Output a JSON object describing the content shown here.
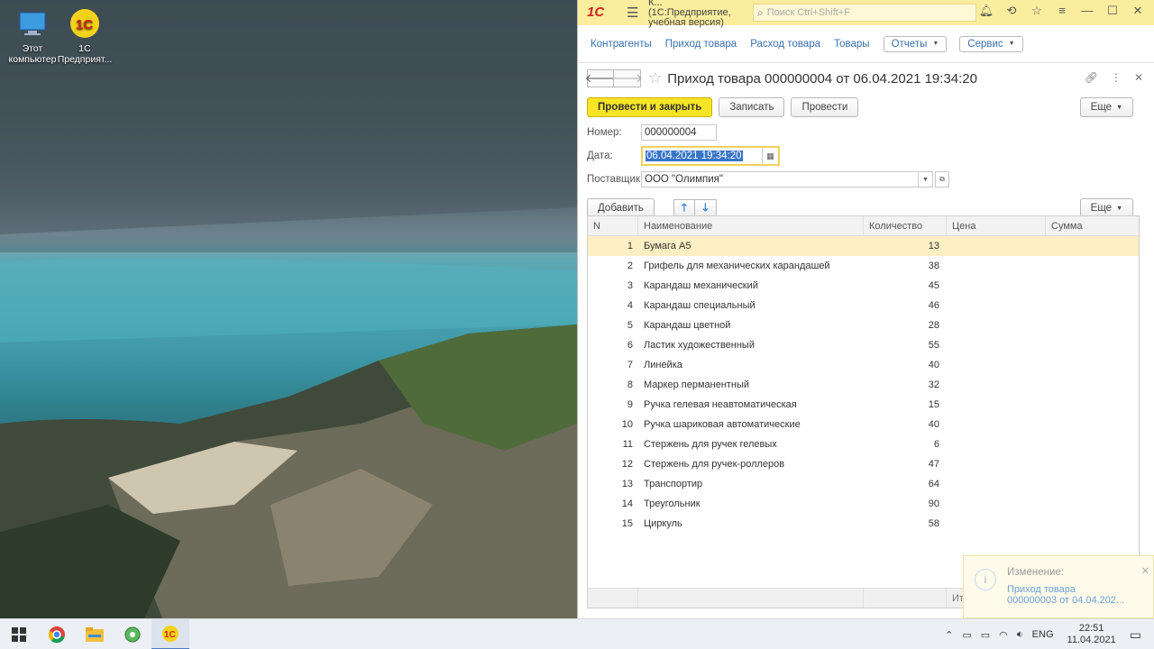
{
  "desktop": {
    "icons": [
      {
        "label": "Этот компьютер",
        "icon": "computer-icon"
      },
      {
        "label": "1С Предприят...",
        "icon": "1c-icon"
      }
    ]
  },
  "app": {
    "logo": "1С",
    "title_line1": "К... (1С:Предприятие,",
    "title_line2": "учебная версия)",
    "search_placeholder": "Поиск Ctrl+Shift+F",
    "sections": [
      "Контрагенты",
      "Приход товара",
      "Расход товара",
      "Товары"
    ],
    "reports_label": "Отчеты",
    "service_label": "Сервис"
  },
  "form": {
    "title": "Приход товара 000000004 от 06.04.2021 19:34:20",
    "post_close_label": "Провести и закрыть",
    "write_label": "Записать",
    "post_label": "Провести",
    "more_label": "Еще",
    "number_label": "Номер:",
    "number_value": "000000004",
    "date_label": "Дата:",
    "date_value": "06.04.2021 19:34:20",
    "supplier_label": "Поставщик:",
    "supplier_value": "ООО \"Олимпия\"",
    "add_label": "Добавить",
    "table_more_label": "Еще"
  },
  "table": {
    "columns": [
      "N",
      "Наименование",
      "Количество",
      "Цена",
      "Сумма"
    ],
    "rows": [
      {
        "n": "1",
        "name": "Бумага А5",
        "qty": "13"
      },
      {
        "n": "2",
        "name": "Грифель для механических карандашей",
        "qty": "38"
      },
      {
        "n": "3",
        "name": "Карандаш механический",
        "qty": "45"
      },
      {
        "n": "4",
        "name": "Карандаш специальный",
        "qty": "46"
      },
      {
        "n": "5",
        "name": "Карандаш цветной",
        "qty": "28"
      },
      {
        "n": "6",
        "name": "Ластик художественный",
        "qty": "55"
      },
      {
        "n": "7",
        "name": "Линейка",
        "qty": "40"
      },
      {
        "n": "8",
        "name": "Маркер перманентный",
        "qty": "32"
      },
      {
        "n": "9",
        "name": "Ручка гелевая неавтоматическая",
        "qty": "15"
      },
      {
        "n": "10",
        "name": "Ручка шариковая автоматические",
        "qty": "40"
      },
      {
        "n": "11",
        "name": "Стержень для ручек гелевых",
        "qty": "6"
      },
      {
        "n": "12",
        "name": "Стержень для ручек-роллеров",
        "qty": "47"
      },
      {
        "n": "13",
        "name": "Транспортир",
        "qty": "64"
      },
      {
        "n": "14",
        "name": "Треугольник",
        "qty": "90"
      },
      {
        "n": "15",
        "name": "Циркуль",
        "qty": "58"
      }
    ],
    "total_label": "Итого:"
  },
  "notification": {
    "title": "Изменение:",
    "line1": "Приход товара",
    "line2": "000000003 от 04.04.202..."
  },
  "taskbar": {
    "lang": "ENG",
    "time": "22:51",
    "date": "11.04.2021"
  }
}
